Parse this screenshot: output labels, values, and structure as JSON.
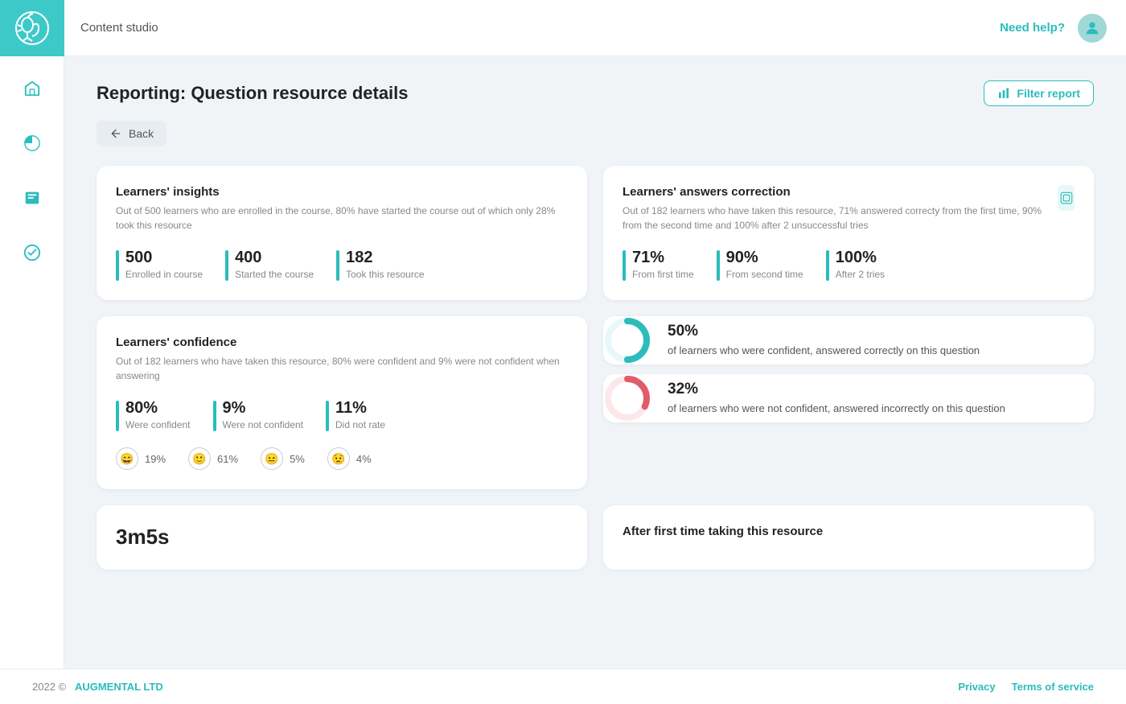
{
  "app": {
    "title": "Content studio",
    "need_help": "Need help?",
    "footer_year": "2022 ©",
    "footer_company": "AUGMENTAL LTD",
    "footer_privacy": "Privacy",
    "footer_terms": "Terms of service"
  },
  "page": {
    "title": "Reporting: Question resource details",
    "filter_btn": "Filter report",
    "back_btn": "Back"
  },
  "learners_insights": {
    "title": "Learners' insights",
    "desc": "Out of 500 learners who are enrolled in the course, 80% have started the course out of which only 28% took this resource",
    "stats": [
      {
        "number": "500",
        "label": "Enrolled in course"
      },
      {
        "number": "400",
        "label": "Started the course"
      },
      {
        "number": "182",
        "label": "Took this resource"
      }
    ]
  },
  "answers_correction": {
    "title": "Learners' answers correction",
    "desc": "Out of 182 learners who have taken this resource, 71% answered correcty from the first time, 90% from the second time and 100% after 2 unsuccessful tries",
    "stats": [
      {
        "number": "71%",
        "label": "From first time"
      },
      {
        "number": "90%",
        "label": "From second time"
      },
      {
        "number": "100%",
        "label": "After 2 tries"
      }
    ]
  },
  "learners_confidence": {
    "title": "Learners' confidence",
    "desc": "Out of 182 learners who have taken this resource, 80% were confident and 9% were not confident when answering",
    "stats": [
      {
        "number": "80%",
        "label": "Were confident"
      },
      {
        "number": "9%",
        "label": "Were not confident"
      },
      {
        "number": "11%",
        "label": "Did not rate"
      }
    ],
    "emojis": [
      {
        "face": "😄",
        "value": "19%"
      },
      {
        "face": "🙂",
        "value": "61%"
      },
      {
        "face": "😐",
        "value": "5%"
      },
      {
        "face": "😟",
        "value": "4%"
      }
    ]
  },
  "confident_donut": {
    "percent": "50%",
    "label": "of learners who were confident, answered correctly on this question",
    "value": 50,
    "color": "#2bbcbc",
    "bg_color": "#e8f8f8"
  },
  "not_confident_donut": {
    "percent": "32%",
    "label": "of learners who were not confident, answered incorrectly on this question",
    "value": 32,
    "color": "#e05c6b",
    "bg_color": "#fce8ea"
  },
  "bottom_left": {
    "value": "3m5s"
  },
  "bottom_right": {
    "title": "After first time taking this resource"
  }
}
